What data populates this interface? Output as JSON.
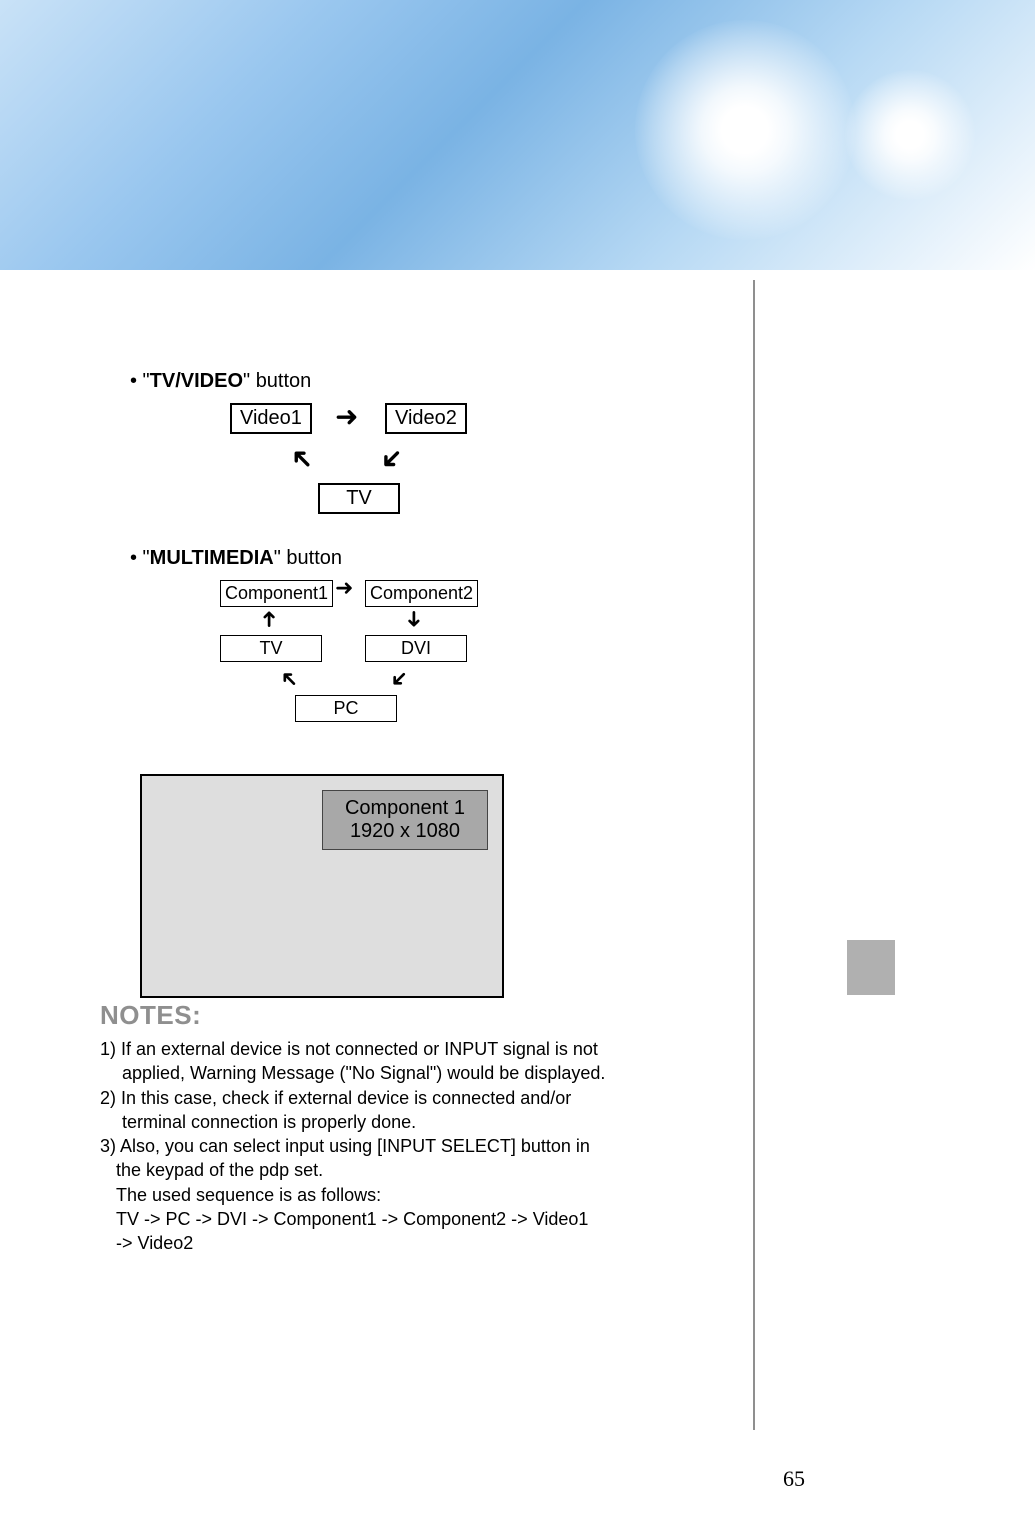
{
  "section1": {
    "prefix": "• \"",
    "bold": "TV/VIDEO",
    "suffix": "\" button",
    "boxes": {
      "video1": "Video1",
      "video2": "Video2",
      "tv": "TV"
    }
  },
  "section2": {
    "prefix": "• \"",
    "bold": "MULTIMEDIA",
    "suffix": "\" button",
    "boxes": {
      "c1": "Component1",
      "c2": "Component2",
      "tv": "TV",
      "dvi": "DVI",
      "pc": "PC"
    }
  },
  "screen": {
    "line1": "Component 1",
    "line2": "1920 x 1080"
  },
  "notes": {
    "title": "NOTES:",
    "n1a": "1)  If an external device is not connected or INPUT signal is not",
    "n1b": "applied, Warning Message (\"No Signal\") would be displayed.",
    "n2a": "2)  In this case, check if external device is connected and/or",
    "n2b": "terminal connection is properly done.",
    "n3a": "3) Also, you can select input using [INPUT SELECT] button in",
    "n3b": "the keypad of the pdp set.",
    "n3c": "The used sequence is as follows:",
    "n3d": "TV -> PC -> DVI -> Component1 -> Component2 -> Video1",
    "n3e": "-> Video2"
  },
  "page": "65"
}
